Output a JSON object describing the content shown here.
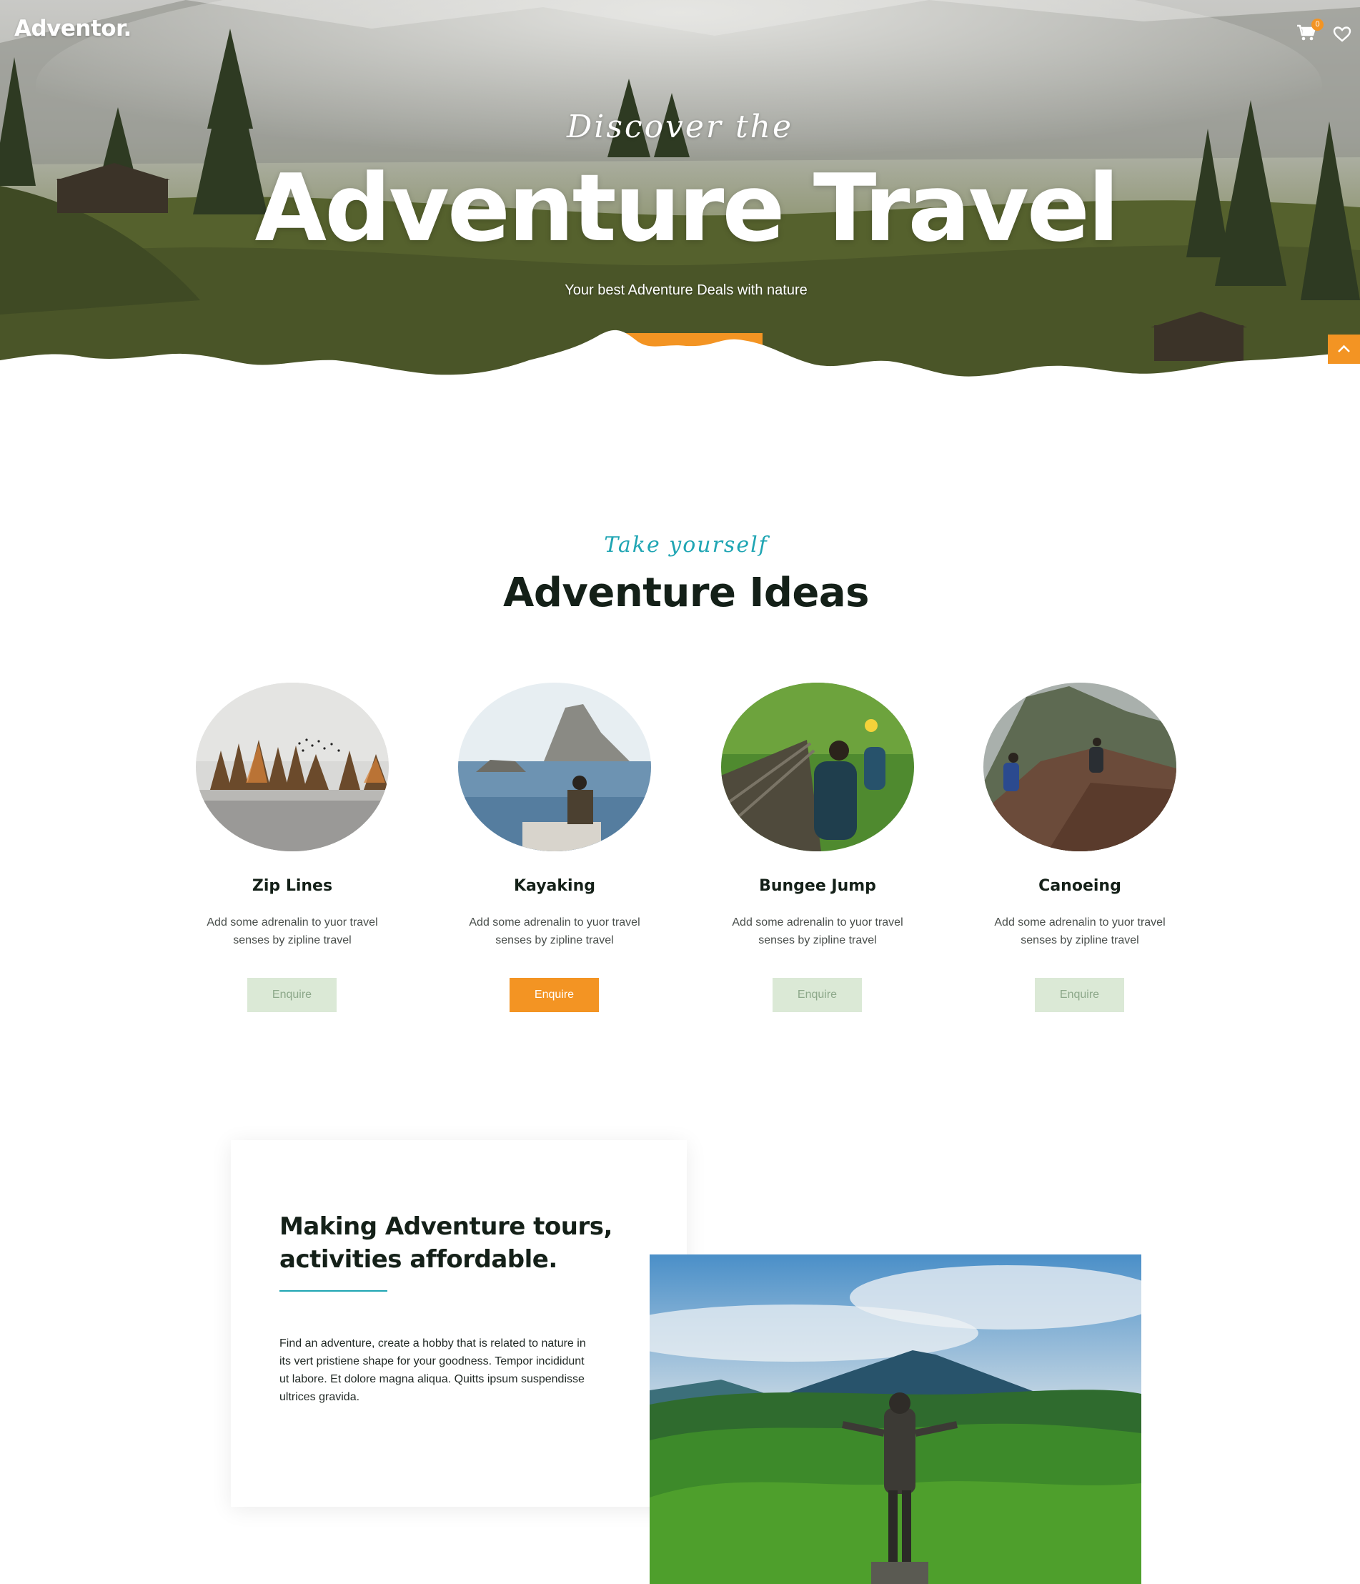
{
  "header": {
    "brand": "Adventor.",
    "cart_count": "0",
    "cart_icon": "cart-icon",
    "wishlist_icon": "heart-icon"
  },
  "hero": {
    "script": "Discover the",
    "title": "Adventure Travel",
    "subtitle": "Your best Adventure Deals with nature",
    "accent": "#f39423"
  },
  "ideas": {
    "script": "Take yourself",
    "title": "Adventure Ideas",
    "cards": [
      {
        "title": "Zip Lines",
        "desc": "Add some adrenalin to yuor travel senses by zipline travel",
        "button": "Enquire"
      },
      {
        "title": "Kayaking",
        "desc": "Add some adrenalin to yuor travel senses by zipline travel",
        "button": "Enquire"
      },
      {
        "title": "Bungee Jump",
        "desc": "Add some adrenalin to yuor travel senses by zipline travel",
        "button": "Enquire"
      },
      {
        "title": "Canoeing",
        "desc": "Add some adrenalin to yuor travel senses by zipline travel",
        "button": "Enquire"
      }
    ]
  },
  "about": {
    "title": "Making Adventure tours, activities affordable.",
    "text": "Find an adventure, create a hobby that is related to nature in its vert pristiene shape for your goodness. Tempor incididunt ut labore. Et dolore magna aliqua. Quitts ipsum suspendisse ultrices gravida."
  },
  "colors": {
    "accent_orange": "#f39423",
    "accent_teal": "#1fa5b3",
    "button_light": "#dbe9d6",
    "heading": "#142018"
  },
  "icons": {
    "scroll_top": "chevron-up-icon"
  }
}
